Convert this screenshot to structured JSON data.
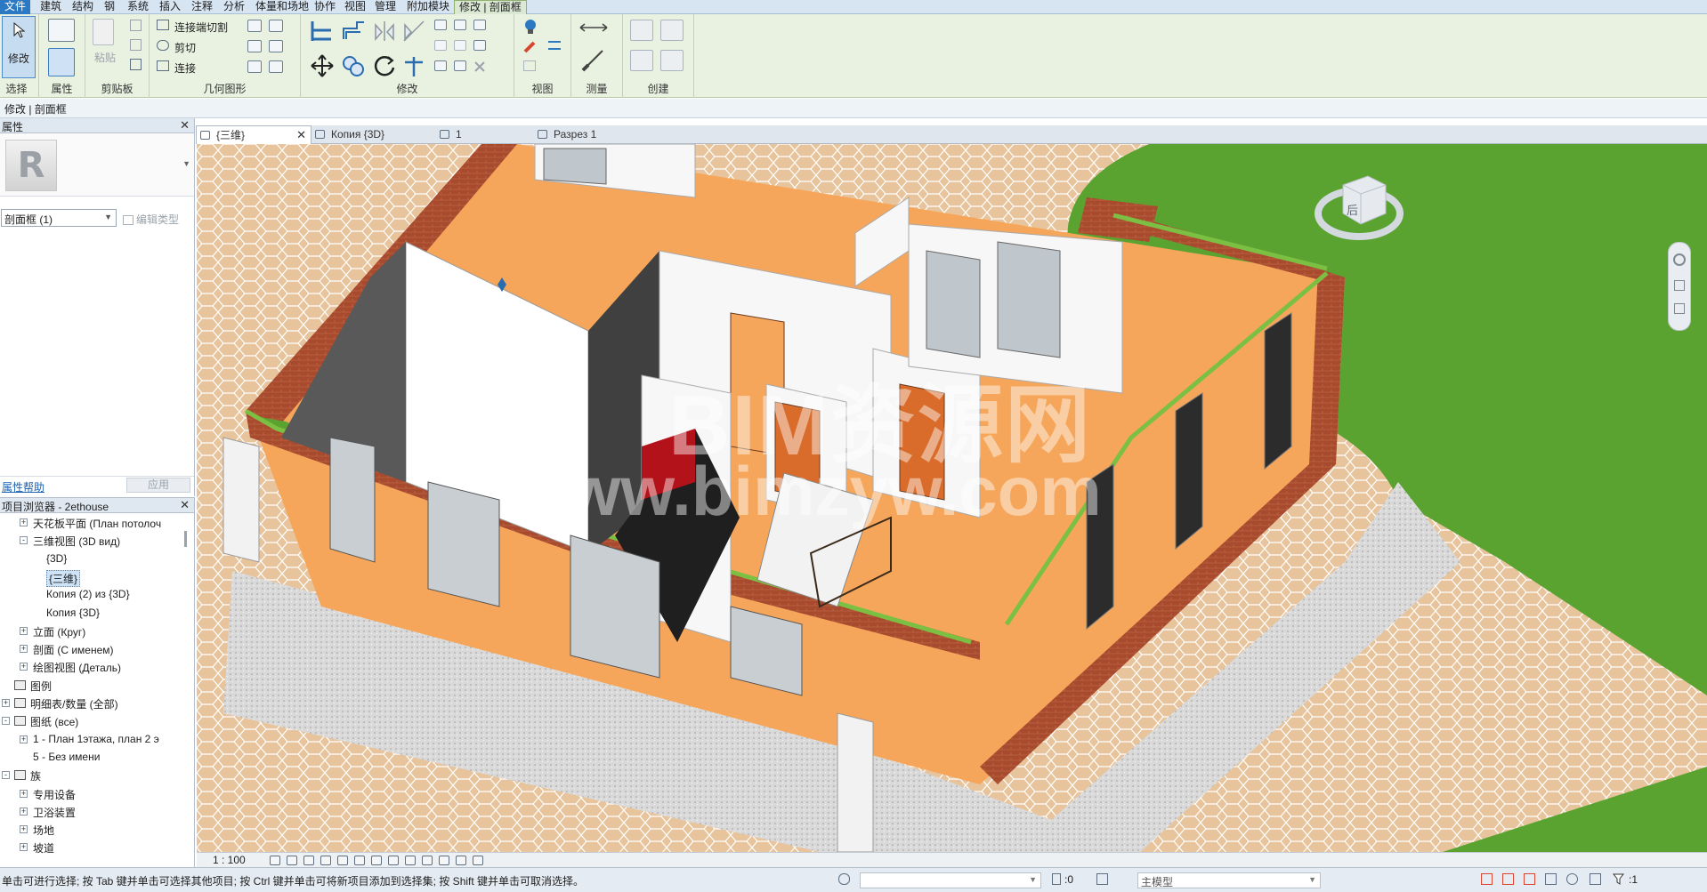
{
  "menu_tabs": [
    "文件",
    "建筑",
    "结构",
    "钢",
    "系统",
    "插入",
    "注释",
    "分析",
    "体量和场地",
    "协作",
    "视图",
    "管理",
    "附加模块",
    "修改 | 剖面框"
  ],
  "ribbon": {
    "modify_label": "修改",
    "select_label": "选择",
    "properties_label": "属性",
    "paste_label": "粘贴",
    "clipboard_label": "剪贴板",
    "geometry_label": "几何图形",
    "cut_join_label": "连接端切割",
    "cut_label": "剪切",
    "join_label": "连接",
    "modify_panel_label": "修改",
    "view_label": "视图",
    "measure_label": "测量",
    "create_label": "创建"
  },
  "context_bar": "修改 | 剖面框",
  "properties": {
    "title": "属性",
    "type_selector": "剖面框 (1)",
    "edit_type": "编辑类型",
    "help_link": "属性帮助",
    "apply_button": "应用"
  },
  "browser": {
    "title": "项目浏览器 - 2ethouse",
    "items": [
      {
        "label": "天花板平面 (План потолоч",
        "level": 1,
        "exp": "+"
      },
      {
        "label": "三维视图 (3D вид)",
        "level": 1,
        "exp": "-"
      },
      {
        "label": "{3D}",
        "level": 2,
        "exp": ""
      },
      {
        "label": "{三维}",
        "level": 2,
        "exp": "",
        "selected": true
      },
      {
        "label": "Копия (2) из {3D}",
        "level": 2,
        "exp": ""
      },
      {
        "label": "Копия {3D}",
        "level": 2,
        "exp": ""
      },
      {
        "label": "立面 (Круг)",
        "level": 1,
        "exp": "+"
      },
      {
        "label": "剖面 (С именем)",
        "level": 1,
        "exp": "+"
      },
      {
        "label": "绘图视图 (Деталь)",
        "level": 1,
        "exp": "+"
      },
      {
        "label": "图例",
        "level": 0,
        "exp": "",
        "icon": true
      },
      {
        "label": "明细表/数量 (全部)",
        "level": 0,
        "exp": "+",
        "icon": true
      },
      {
        "label": "图纸 (все)",
        "level": 0,
        "exp": "-",
        "icon": true
      },
      {
        "label": "1 - План 1этажа, план 2 э",
        "level": 1,
        "exp": "+"
      },
      {
        "label": "5 - Без имени",
        "level": 1,
        "exp": ""
      },
      {
        "label": "族",
        "level": 0,
        "exp": "-",
        "icon": true
      },
      {
        "label": "专用设备",
        "level": 1,
        "exp": "+"
      },
      {
        "label": "卫浴装置",
        "level": 1,
        "exp": "+"
      },
      {
        "label": "场地",
        "level": 1,
        "exp": "+"
      },
      {
        "label": "坡道",
        "level": 1,
        "exp": "+"
      }
    ]
  },
  "view_tabs": [
    {
      "label": "{三维}",
      "active": true
    },
    {
      "label": "Копия {3D}",
      "active": false
    },
    {
      "label": "1",
      "active": false
    },
    {
      "label": "Разрез 1",
      "active": false
    }
  ],
  "viewport": {
    "watermark_top": "BIM资源网",
    "watermark_bottom": "www.bimzyw.com",
    "viewcube_label": "后"
  },
  "view_control": {
    "scale": "1 : 100"
  },
  "status": {
    "text": "单击可进行选择; 按 Tab 键并单击可选择其他项目; 按 Ctrl 键并单击可将新项目添加到选择集; 按 Shift 键并单击可取消选择。",
    "zero_value": ":0",
    "model_selector": "主模型",
    "filter_count": ":1"
  },
  "colors": {
    "accent": "#2b79c2",
    "ribbon_bg": "#e9f2e1",
    "grass": "#5aa331",
    "paving": "#e8c49c",
    "floor": "#f6a65a",
    "brick": "#a84a2e"
  }
}
